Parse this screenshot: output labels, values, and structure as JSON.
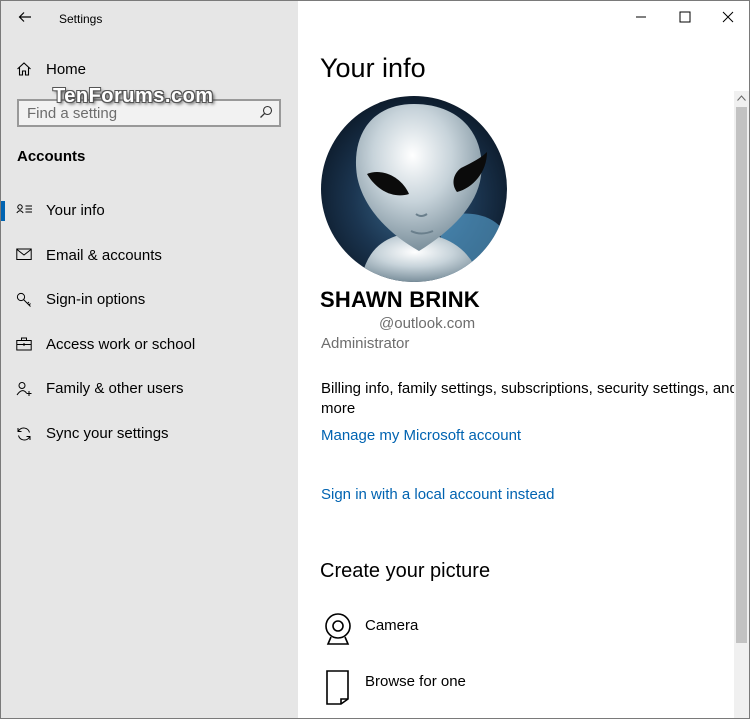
{
  "window": {
    "title": "Settings"
  },
  "watermark": "TenForums.com",
  "sidebar": {
    "home_label": "Home",
    "search_placeholder": "Find a setting",
    "section_title": "Accounts",
    "items": [
      {
        "label": "Your info",
        "icon": "person-card-icon",
        "active": true
      },
      {
        "label": "Email & accounts",
        "icon": "mail-icon"
      },
      {
        "label": "Sign-in options",
        "icon": "key-icon"
      },
      {
        "label": "Access work or school",
        "icon": "briefcase-icon"
      },
      {
        "label": "Family & other users",
        "icon": "add-person-icon"
      },
      {
        "label": "Sync your settings",
        "icon": "sync-icon"
      }
    ]
  },
  "main": {
    "title": "Your info",
    "user_name": "SHAWN BRINK",
    "email_suffix": "@outlook.com",
    "role": "Administrator",
    "description": "Billing info, family settings, subscriptions, security settings, and more",
    "manage_link": "Manage my Microsoft account",
    "local_link": "Sign in with a local account instead",
    "create_picture_title": "Create your picture",
    "options": [
      {
        "label": "Camera",
        "icon": "camera-icon"
      },
      {
        "label": "Browse for one",
        "icon": "browse-file-icon"
      }
    ]
  },
  "colors": {
    "accent": "#0063b1",
    "sidebar_bg": "#e6e6e6",
    "secondary_text": "#6d6d6d"
  }
}
